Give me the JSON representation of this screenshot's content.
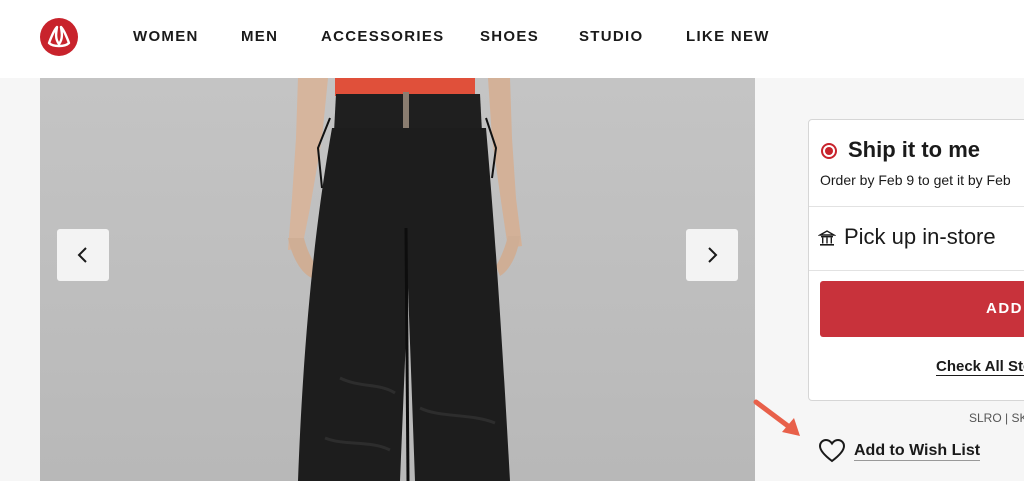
{
  "header": {
    "nav": [
      "WOMEN",
      "MEN",
      "ACCESSORIES",
      "SHOES",
      "STUDIO",
      "LIKE NEW"
    ],
    "logo_icon": "lululemon-logo-icon",
    "brand_color": "#c8232c"
  },
  "gallery": {
    "prev_icon": "chevron-left-icon",
    "next_icon": "chevron-right-icon",
    "colors": {
      "backdrop": "#c2c2c2",
      "pants": "#1d1d1d",
      "top": "#e0503a"
    }
  },
  "fulfillment": {
    "ship_title": "Ship it to me",
    "ship_subtitle": "Order by Feb 9 to get it by Feb",
    "pickup_title": "Pick up in-store",
    "add_button": "ADD",
    "check_link": "Check All Sto"
  },
  "product": {
    "sku_fragment": "SLRO | SK"
  },
  "wishlist": {
    "label": "Add to Wish List",
    "icon": "heart-icon"
  },
  "annotation": {
    "icon": "red-arrow-icon",
    "color": "#e8604a"
  }
}
